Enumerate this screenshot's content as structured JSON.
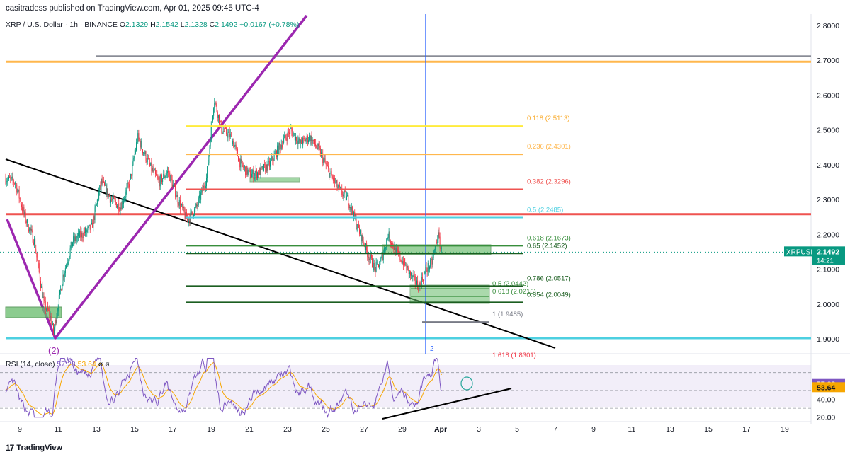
{
  "header": {
    "publisher": "casitradess published on TradingView.com, Apr 01, 2025 09:45 UTC-4",
    "symbol_line": "XRP / U.S. Dollar · 1h · BINANCE",
    "ohlc": [
      {
        "k": "O",
        "v": "2.1329"
      },
      {
        "k": "H",
        "v": "2.1542"
      },
      {
        "k": "L",
        "v": "2.1328"
      },
      {
        "k": "C",
        "v": "2.1492"
      }
    ],
    "change": "+0.0167 (+0.78%)"
  },
  "price_tag": {
    "symbol": "XRPUSD",
    "price": "2.1492",
    "countdown": "14:21"
  },
  "rsi_legend": {
    "label": "RSI (14, close)",
    "v1": "57.28",
    "v2": "53.64",
    "extra": "ø ø"
  },
  "rsi_tags": {
    "rsi": "57.28",
    "ma": "53.64"
  },
  "brand": "TradingView",
  "colors": {
    "up": "#089981",
    "down": "#f23645",
    "rsi": "#7e57c2",
    "rsi_ma": "#f7a600",
    "purple_line": "#9c27b0",
    "fib_green": "#388e3c",
    "fib_yellow": "#ffeb3b",
    "fib_orange": "#ffb74d",
    "fib_red": "#ef5350",
    "fib_cyan": "#4dd0e1",
    "blue_vline": "#2962ff"
  },
  "annotations": {
    "wave_label": "(2)",
    "vline_label": "2"
  },
  "chart_data": [
    {
      "type": "candlestick",
      "symbol": "XRPUSD",
      "timeframe": "1h",
      "price_axis": {
        "ticks": [
          "2.8000",
          "2.7000",
          "2.6000",
          "2.5000",
          "2.4000",
          "2.3000",
          "2.2000",
          "2.1000",
          "2.0000",
          "1.9000"
        ],
        "range": [
          1.88,
          2.82
        ]
      },
      "time_axis": {
        "ticks": [
          "9",
          "11",
          "13",
          "15",
          "17",
          "19",
          "21",
          "23",
          "25",
          "27",
          "29",
          "Apr",
          "3",
          "5",
          "7",
          "9",
          "11",
          "13",
          "15",
          "17",
          "19"
        ]
      },
      "path_points": [
        [
          0,
          2.36
        ],
        [
          0.5,
          2.35
        ],
        [
          1.0,
          2.25
        ],
        [
          1.5,
          2.18
        ],
        [
          2.0,
          2.0
        ],
        [
          2.3,
          1.97
        ],
        [
          2.5,
          1.92
        ],
        [
          3.0,
          2.08
        ],
        [
          3.5,
          2.18
        ],
        [
          4.0,
          2.2
        ],
        [
          4.5,
          2.22
        ],
        [
          5.0,
          2.35
        ],
        [
          5.5,
          2.3
        ],
        [
          6.0,
          2.28
        ],
        [
          6.5,
          2.35
        ],
        [
          6.9,
          2.48
        ],
        [
          7.5,
          2.4
        ],
        [
          8.0,
          2.35
        ],
        [
          8.5,
          2.38
        ],
        [
          9.0,
          2.3
        ],
        [
          9.5,
          2.24
        ],
        [
          10.0,
          2.28
        ],
        [
          10.5,
          2.36
        ],
        [
          10.9,
          2.59
        ],
        [
          11.3,
          2.5
        ],
        [
          11.8,
          2.48
        ],
        [
          12.3,
          2.4
        ],
        [
          12.8,
          2.37
        ],
        [
          13.3,
          2.38
        ],
        [
          13.8,
          2.4
        ],
        [
          14.3,
          2.45
        ],
        [
          14.9,
          2.5
        ],
        [
          15.4,
          2.46
        ],
        [
          15.9,
          2.48
        ],
        [
          16.4,
          2.44
        ],
        [
          16.9,
          2.38
        ],
        [
          17.4,
          2.33
        ],
        [
          17.9,
          2.3
        ],
        [
          18.4,
          2.22
        ],
        [
          18.9,
          2.15
        ],
        [
          19.3,
          2.1
        ],
        [
          19.6,
          2.12
        ],
        [
          20.0,
          2.2
        ],
        [
          20.4,
          2.15
        ],
        [
          20.8,
          2.12
        ],
        [
          21.2,
          2.08
        ],
        [
          21.6,
          2.05
        ],
        [
          22.0,
          2.1
        ],
        [
          22.3,
          2.12
        ],
        [
          22.6,
          2.2
        ],
        [
          22.8,
          2.149
        ]
      ],
      "last_price": 2.1492,
      "horizontal_levels": [
        {
          "price": 2.7123,
          "color": "#787b86"
        },
        {
          "price": 2.696,
          "color": "#ffb74d"
        },
        {
          "price": 2.258,
          "color": "#ef5350"
        },
        {
          "price": 1.902,
          "color": "#4dd0e1"
        }
      ],
      "fib_levels": [
        {
          "label": "0.118 (2.5113)",
          "price": 2.5113,
          "color": "#ffeb3b"
        },
        {
          "label": "0.236 (2.4301)",
          "price": 2.4301,
          "color": "#ffb74d"
        },
        {
          "label": "0.382 (2.3296)",
          "price": 2.3296,
          "color": "#ef5350"
        },
        {
          "label": "0.5 (2.2485)",
          "price": 2.2485,
          "color": "#4dd0e1"
        },
        {
          "label": "0.618 (2.1673)",
          "price": 2.1673,
          "color": "#388e3c"
        },
        {
          "label": "0.65 (2.1452)",
          "price": 2.1452,
          "color": "#1b5e20"
        }
      ],
      "fib_levels_2": [
        {
          "label": "0.5 (2.0442)",
          "price": 2.0442,
          "color": "#388e3c"
        },
        {
          "label": "0.618 (2.0216)",
          "price": 2.0216,
          "color": "#388e3c"
        },
        {
          "label": "0.786 (2.0517)",
          "price": 2.0517,
          "color": "#1b5e20"
        },
        {
          "label": "0.854 (2.0049)",
          "price": 2.0049,
          "color": "#1b5e20"
        },
        {
          "label": "1 (1.9485)",
          "price": 1.9485,
          "color": "#787b86"
        },
        {
          "label": "1.618 (1.8301)",
          "price": 1.8301,
          "color": "#f23645"
        }
      ]
    },
    {
      "type": "line",
      "title": "RSI (14, close)",
      "y_ticks": [
        "40.00",
        "20.00"
      ],
      "range": [
        15,
        90
      ],
      "last_values": {
        "rsi": 57.28,
        "ma": 53.64
      }
    }
  ]
}
